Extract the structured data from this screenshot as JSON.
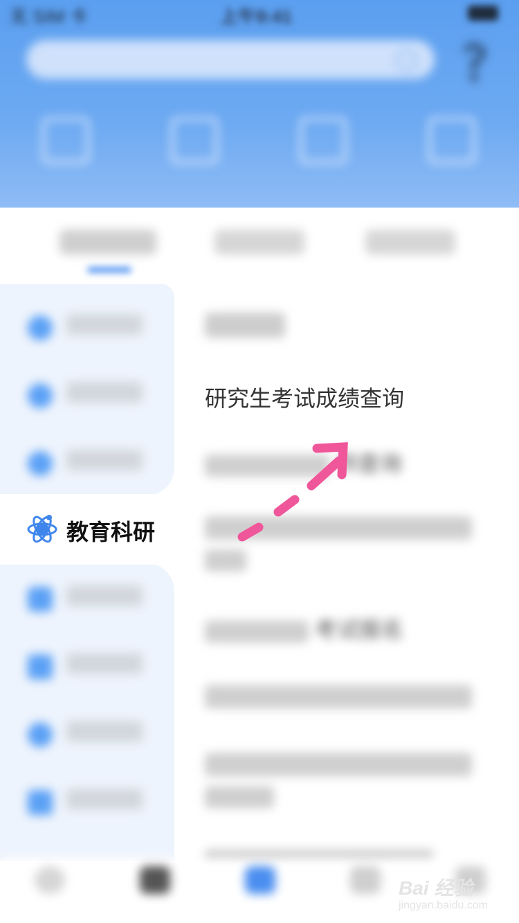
{
  "status_bar": {
    "carrier": "无 SIM 卡",
    "time": "上午9:41",
    "battery": ""
  },
  "search": {
    "placeholder": ""
  },
  "categories": [
    {
      "label": "",
      "icon": "id-card-icon"
    },
    {
      "label": "",
      "icon": "bank-icon"
    },
    {
      "label": "",
      "icon": "map-icon"
    },
    {
      "label": "",
      "icon": "folder-icon"
    }
  ],
  "tabs": [
    {
      "label": ""
    },
    {
      "label": ""
    },
    {
      "label": ""
    }
  ],
  "sidebar": {
    "items": [
      {
        "label": "",
        "icon": "person-icon"
      },
      {
        "label": "",
        "icon": "circle-icon"
      },
      {
        "label": "",
        "icon": "circle-icon"
      },
      {
        "label": "教育科研",
        "icon": "atom-icon",
        "active": true
      },
      {
        "label": "",
        "icon": "briefcase-icon"
      },
      {
        "label": "",
        "icon": "document-icon"
      },
      {
        "label": "",
        "icon": "circle-icon"
      },
      {
        "label": "",
        "icon": "house-icon"
      }
    ]
  },
  "content": {
    "items": [
      {
        "label": "",
        "blurred": true
      },
      {
        "label": "研究生考试成绩查询",
        "blurred": false
      },
      {
        "label": "书查询",
        "blurred": true
      },
      {
        "label": "",
        "blurred": true
      },
      {
        "label": "考试报名",
        "blurred": true
      },
      {
        "label": "",
        "blurred": true
      },
      {
        "label": "",
        "blurred": true
      },
      {
        "label": "",
        "blurred": true
      }
    ]
  },
  "bottom_nav": [
    {
      "label": "",
      "icon": "home-icon"
    },
    {
      "label": "",
      "icon": "grid-icon"
    },
    {
      "label": "",
      "icon": "service-icon",
      "active": true
    },
    {
      "label": "",
      "icon": "doc-icon"
    },
    {
      "label": "",
      "icon": "user-icon"
    }
  ],
  "watermark": {
    "brand": "Bai 经验",
    "url": "jingyan.baidu.com"
  },
  "colors": {
    "accent": "#4a8ef0",
    "header": "#5b9ff0",
    "sidebar_bg": "#eef4fd",
    "arrow": "#f0569a"
  }
}
